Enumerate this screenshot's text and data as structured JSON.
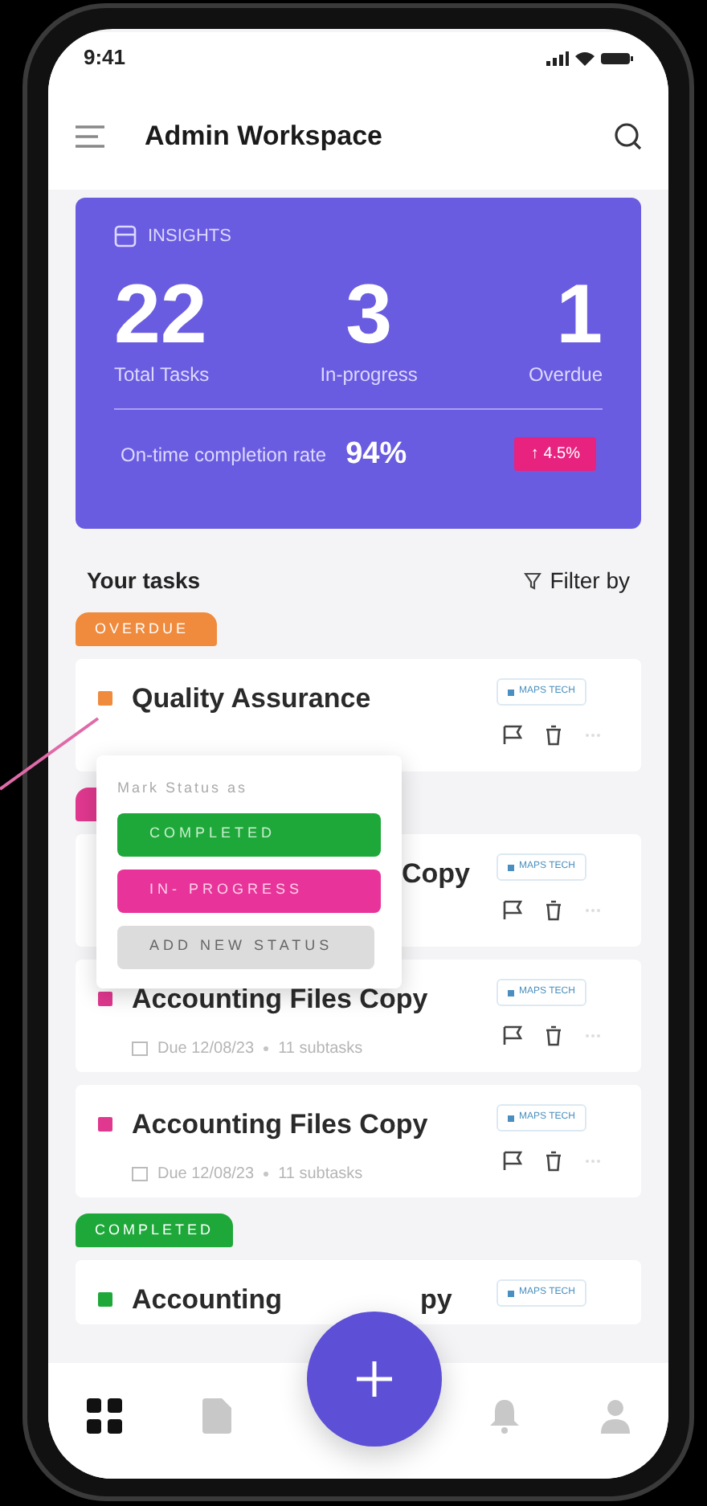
{
  "status_bar": {
    "time": "9:41"
  },
  "header": {
    "title": "Admin Workspace"
  },
  "insights": {
    "label": "INSIGHTS",
    "stats": [
      {
        "value": "22",
        "label": "Total Tasks"
      },
      {
        "value": "3",
        "label": "In-progress"
      },
      {
        "value": "1",
        "label": "Overdue"
      }
    ],
    "rate_label": "On-time completion rate",
    "rate": "94%",
    "change": "↑ 4.5%"
  },
  "tasks_header": {
    "title": "Your tasks",
    "filter": "Filter by"
  },
  "groups": [
    {
      "status": "OVERDUE",
      "color": "#f08a3c",
      "tasks": [
        {
          "kind": "full",
          "title": "Quality Assurance",
          "tag": "MAPS TECH"
        }
      ]
    },
    {
      "color": "#e0388f",
      "tasks": [
        {
          "kind": "covered",
          "title": "Copy",
          "tag": "MAPS TECH"
        },
        {
          "kind": "full",
          "title": "Accounting Files Copy",
          "due": "Due 12/08/23",
          "subtasks": "11 subtasks",
          "tag": "MAPS TECH"
        },
        {
          "kind": "full",
          "title": "Accounting Files Copy",
          "due": "Due 12/08/23",
          "subtasks": "11 subtasks",
          "tag": "MAPS TECH"
        }
      ]
    },
    {
      "status": "COMPLETED",
      "color": "#1fa83a",
      "tasks": [
        {
          "kind": "split",
          "title": "Accounting",
          "title_tail": "py",
          "tag": "MAPS TECH"
        }
      ]
    }
  ],
  "popup": {
    "title": "Mark Status as",
    "options": [
      {
        "kind": "completed",
        "label": "COMPLETED"
      },
      {
        "kind": "in_progress",
        "label": "IN- PROGRESS"
      },
      {
        "kind": "add",
        "label": "ADD NEW STATUS"
      }
    ]
  },
  "nav": [
    {
      "kind": "grid",
      "selected": true
    },
    {
      "kind": "document",
      "selected": false
    },
    {
      "kind": "bell",
      "selected": false
    },
    {
      "kind": "user",
      "selected": false
    }
  ]
}
